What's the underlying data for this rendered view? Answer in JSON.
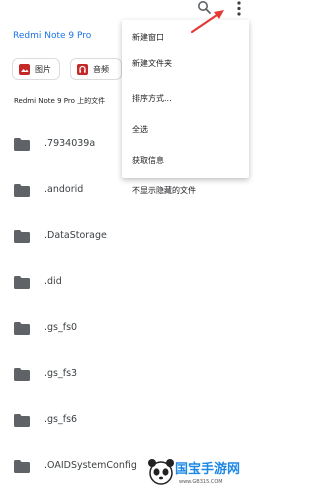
{
  "header": {
    "search_icon": "search-icon",
    "more_icon": "more-vert-icon"
  },
  "location_title": "Redmi Note 9 Pro",
  "chips": [
    {
      "label": "图片",
      "icon": "image-icon"
    },
    {
      "label": "音频",
      "icon": "audio-icon"
    }
  ],
  "section_title": "Redmi Note 9 Pro 上的文件",
  "files": [
    {
      "name": ".7934039a"
    },
    {
      "name": ".andorid"
    },
    {
      "name": ".DataStorage"
    },
    {
      "name": ".did"
    },
    {
      "name": ".gs_fs0"
    },
    {
      "name": ".gs_fs3"
    },
    {
      "name": ".gs_fs6"
    },
    {
      "name": ".OAIDSystemConfig"
    }
  ],
  "menu": {
    "items": [
      {
        "label": "新建窗口"
      },
      {
        "label": "新建文件夹"
      },
      {
        "label": "排序方式..."
      },
      {
        "label": "全选"
      },
      {
        "label": "获取信息"
      },
      {
        "label": "不显示隐藏的文件"
      }
    ]
  },
  "watermark": {
    "title": "国宝手游网",
    "url": "www.GB315.COM"
  },
  "colors": {
    "accent": "#1a73e8",
    "chip_icon": "#c62828",
    "arrow": "#e53935",
    "folder": "#5f6368"
  }
}
